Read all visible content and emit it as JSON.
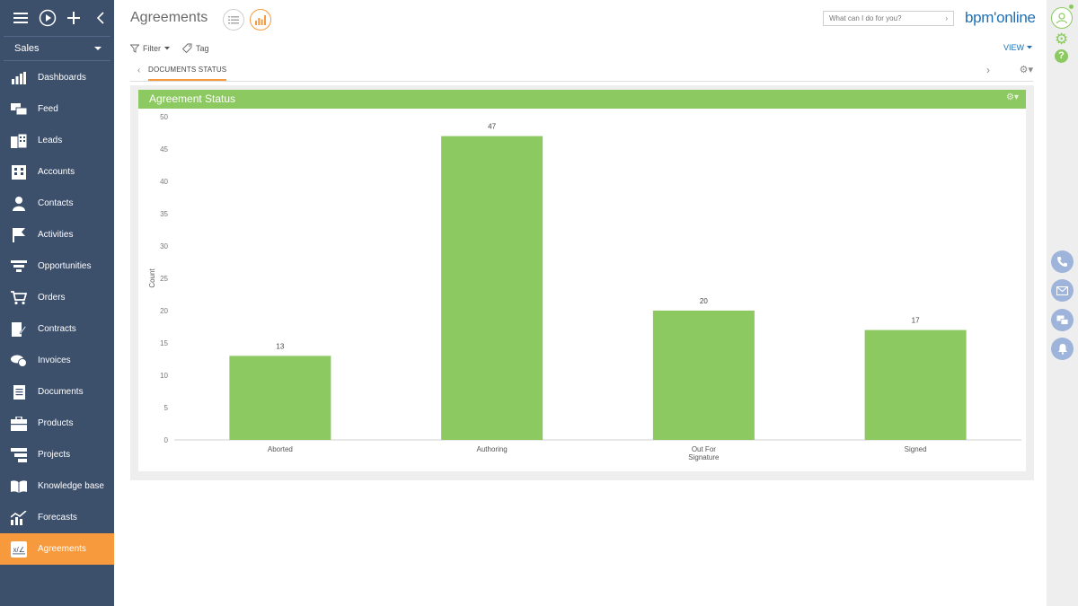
{
  "sidebar": {
    "workspace": "Sales",
    "items": [
      {
        "label": "Dashboards",
        "icon": "dashboards-icon",
        "active": false
      },
      {
        "label": "Feed",
        "icon": "feed-icon",
        "active": false
      },
      {
        "label": "Leads",
        "icon": "leads-icon",
        "active": false
      },
      {
        "label": "Accounts",
        "icon": "accounts-icon",
        "active": false
      },
      {
        "label": "Contacts",
        "icon": "contacts-icon",
        "active": false
      },
      {
        "label": "Activities",
        "icon": "activities-icon",
        "active": false
      },
      {
        "label": "Opportunities",
        "icon": "opportunities-icon",
        "active": false
      },
      {
        "label": "Orders",
        "icon": "orders-icon",
        "active": false
      },
      {
        "label": "Contracts",
        "icon": "contracts-icon",
        "active": false
      },
      {
        "label": "Invoices",
        "icon": "invoices-icon",
        "active": false
      },
      {
        "label": "Documents",
        "icon": "documents-icon",
        "active": false
      },
      {
        "label": "Products",
        "icon": "products-icon",
        "active": false
      },
      {
        "label": "Projects",
        "icon": "projects-icon",
        "active": false
      },
      {
        "label": "Knowledge base",
        "icon": "knowledge-base-icon",
        "active": false
      },
      {
        "label": "Forecasts",
        "icon": "forecasts-icon",
        "active": false
      },
      {
        "label": "Agreements",
        "icon": "agreements-icon",
        "active": true
      }
    ]
  },
  "header": {
    "title": "Agreements",
    "search_placeholder": "What can I do for you?",
    "logo": "bpm'online"
  },
  "toolbar": {
    "filter_label": "Filter",
    "tag_label": "Tag",
    "view_label": "VIEW"
  },
  "tabs": {
    "active_label": "DOCUMENTS STATUS"
  },
  "widget": {
    "title": "Agreement Status"
  },
  "colors": {
    "sidebar": "#3c4f6b",
    "accent": "#f79a3e",
    "bar": "#8cc960",
    "brand": "#1f6fb2"
  },
  "chart_data": {
    "type": "bar",
    "categories": [
      "Aborted",
      "Authoring",
      "Out For Signature",
      "Signed"
    ],
    "category_lines": [
      [
        "Aborted"
      ],
      [
        "Authoring"
      ],
      [
        "Out For",
        "Signature"
      ],
      [
        "Signed"
      ]
    ],
    "values": [
      13,
      47,
      20,
      17
    ],
    "title": "",
    "xlabel": "",
    "ylabel": "Count",
    "ylim": [
      0,
      50
    ],
    "yticks": [
      0,
      5,
      10,
      15,
      20,
      25,
      30,
      35,
      40,
      45,
      50
    ],
    "grid": false,
    "legend": "none"
  }
}
